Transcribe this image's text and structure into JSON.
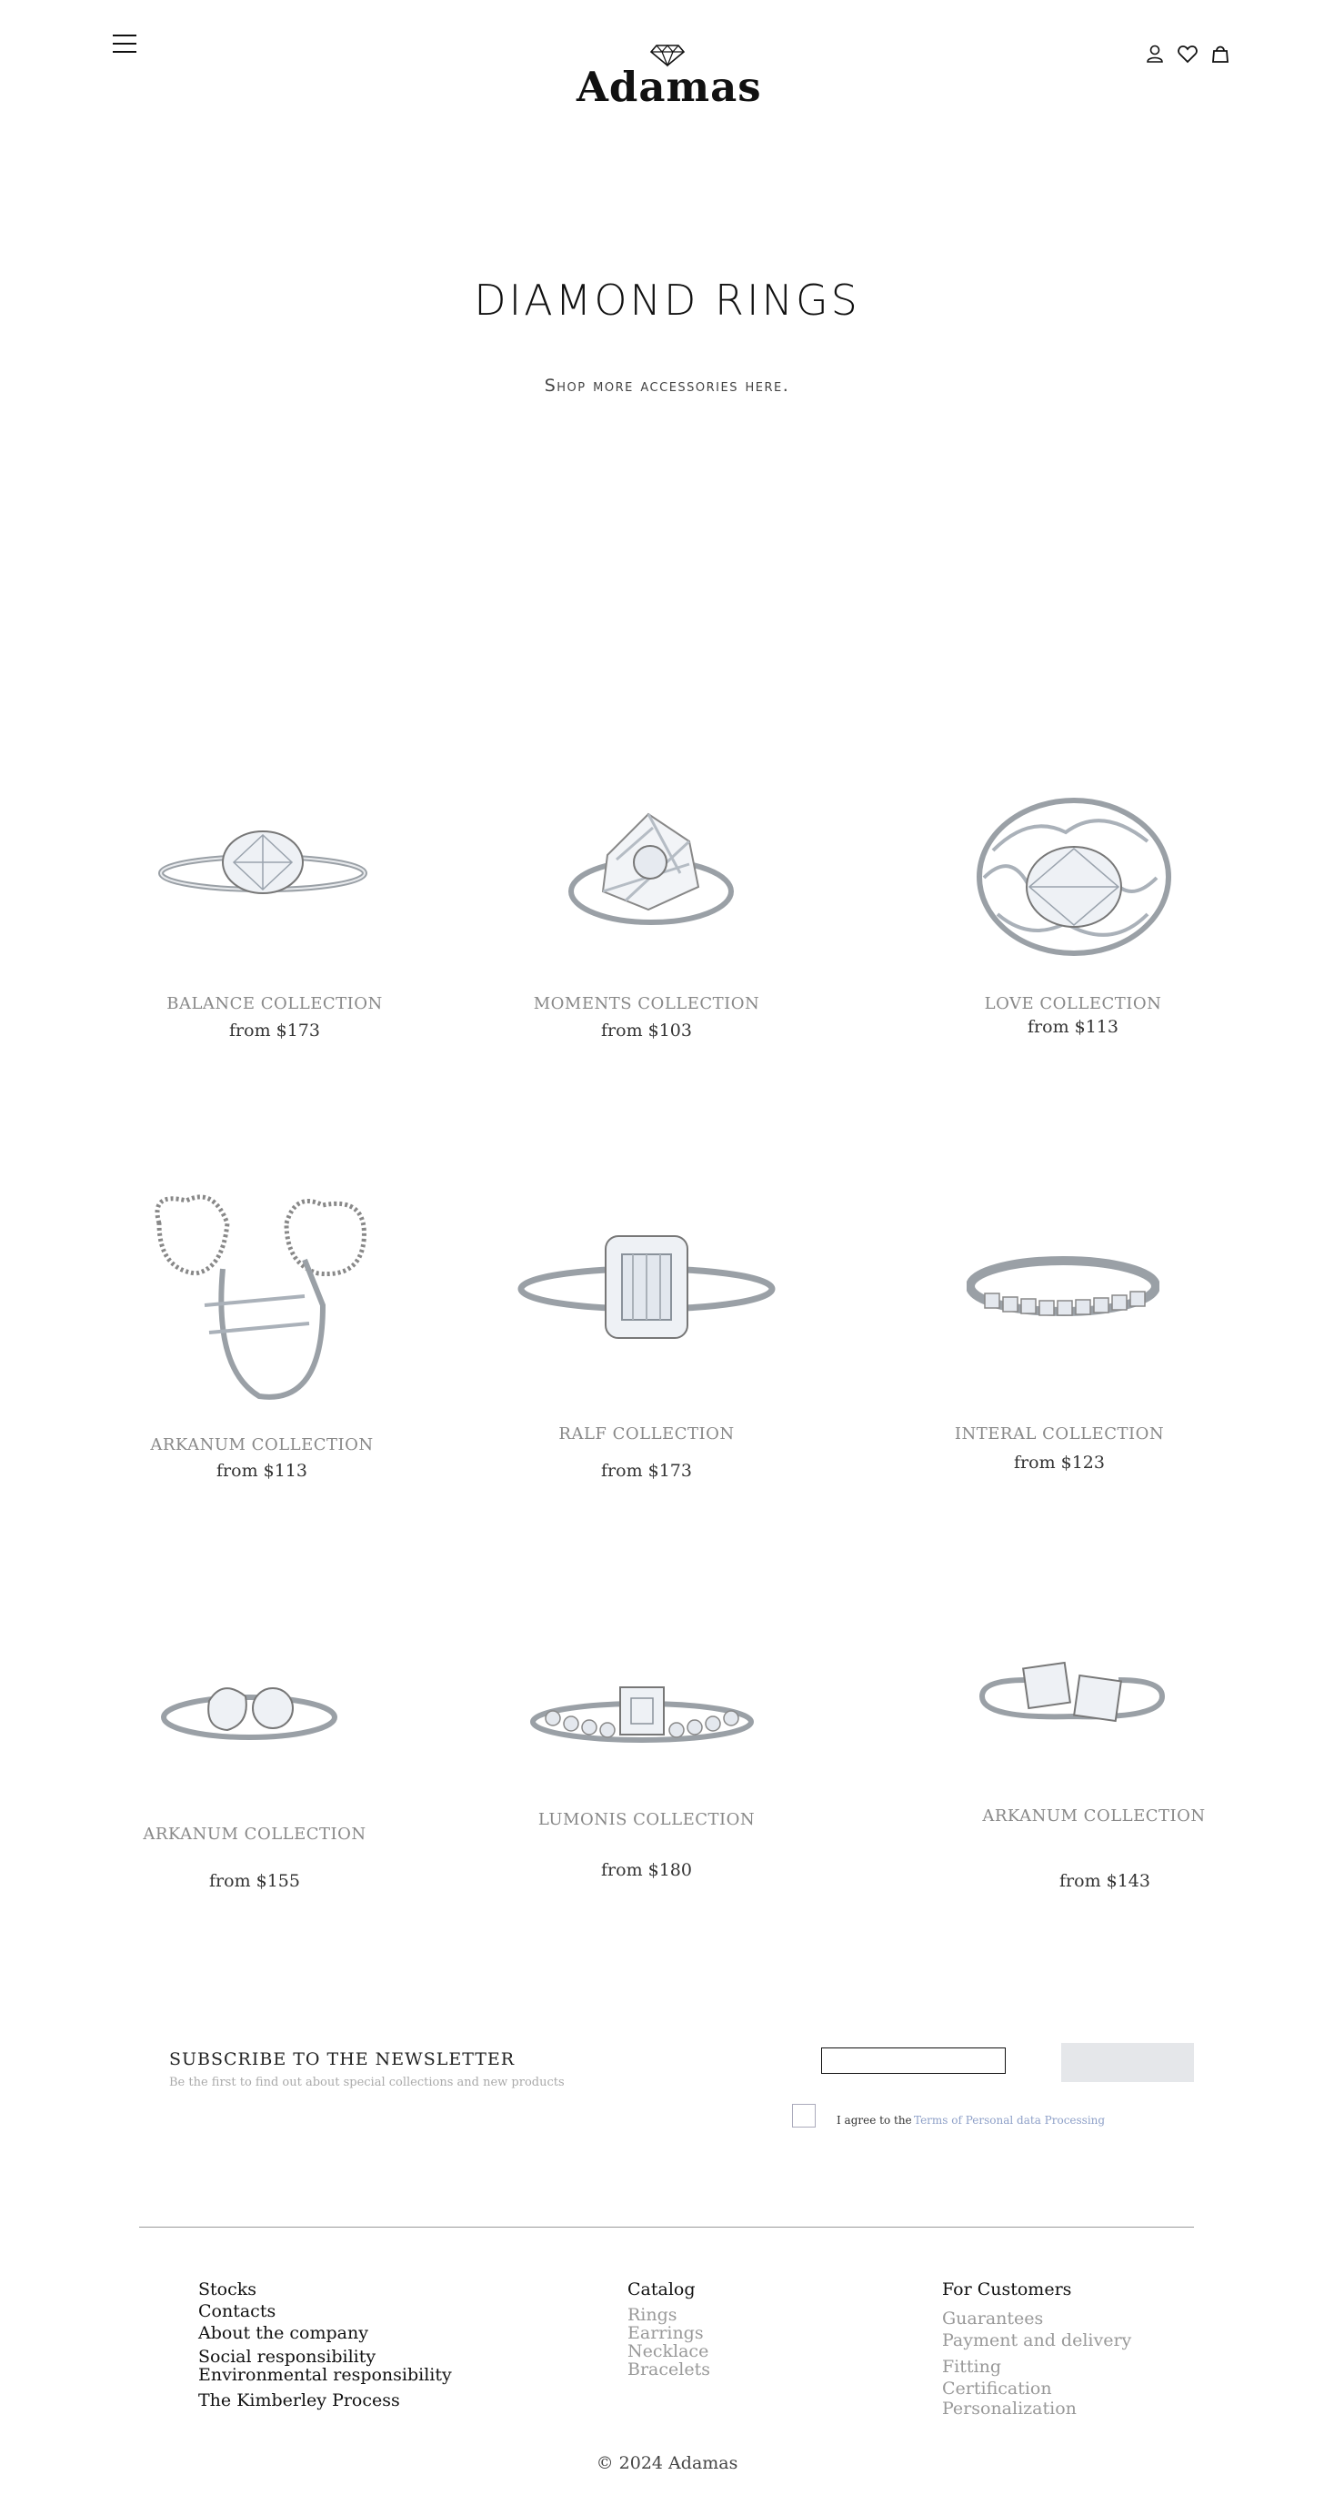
{
  "header": {
    "brand": "Adamas",
    "icons": [
      "menu-icon",
      "user-icon",
      "heart-icon",
      "bag-icon",
      "diamond-icon"
    ]
  },
  "hero": {
    "title": "DIAMOND RINGS",
    "subtitle": "Shop more accessories here."
  },
  "products": [
    {
      "name": "BALANCE COLLECTION",
      "price": "from $173"
    },
    {
      "name": "MOMENTS COLLECTION",
      "price": "from $103"
    },
    {
      "name": "LOVE COLLECTION",
      "price": "from $113"
    },
    {
      "name": "ARKANUM COLLECTION",
      "price": "from $113"
    },
    {
      "name": "RALF COLLECTION",
      "price": "from $173"
    },
    {
      "name": "INTERAL COLLECTION",
      "price": "from $123"
    },
    {
      "name": "ARKANUM COLLECTION",
      "price": "from $155"
    },
    {
      "name": "LUMONIS COLLECTION",
      "price": "from $180"
    },
    {
      "name": "ARKANUM COLLECTION",
      "price": "from $143"
    }
  ],
  "newsletter": {
    "title": "SUBSCRIBE TO THE NEWSLETTER",
    "subtitle": "Be the first to find out about special collections and new products",
    "email_value": "",
    "button_label": "",
    "agree_text": "I agree to the",
    "terms_link": "Terms of Personal data Processing"
  },
  "footer": {
    "col1": [
      "Stocks",
      "Contacts",
      "About the company",
      "Social responsibility",
      "Environmental responsibility",
      "The Kimberley Process"
    ],
    "col2": {
      "heading": "Catalog",
      "items": [
        "Rings",
        "Earrings",
        "Necklace",
        "Bracelets"
      ]
    },
    "col3": {
      "heading": "For Customers",
      "items": [
        "Guarantees",
        "Payment and delivery",
        "Fitting",
        "Certification",
        "Personalization"
      ]
    },
    "copyright": "© 2024 Adamas"
  }
}
